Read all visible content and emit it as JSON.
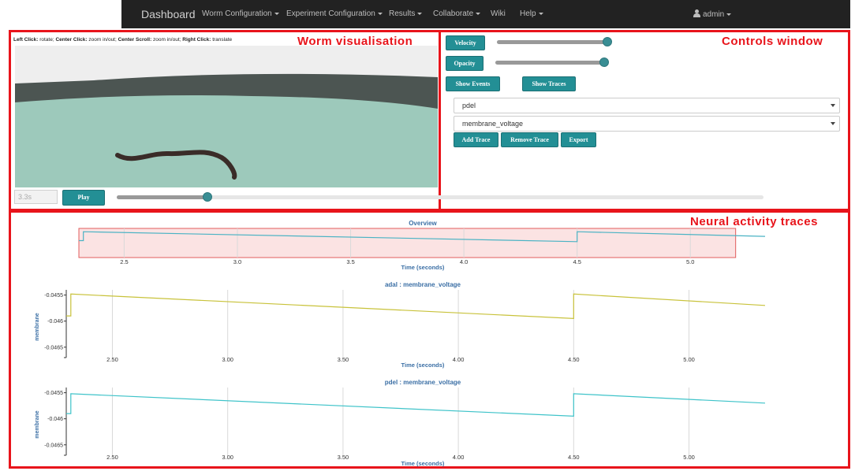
{
  "navbar": {
    "brand": "Dashboard",
    "items": [
      "Worm Configuration",
      "Experiment Configuration",
      "Results",
      "Collaborate",
      "Wiki",
      "Help"
    ],
    "user": "admin"
  },
  "annotations": {
    "worm": "Worm visualisation",
    "controls": "Controls window",
    "traces": "Neural activity traces"
  },
  "worm_view": {
    "hint_parts": [
      {
        "k": "Left Click:",
        "v": " rotate; "
      },
      {
        "k": "Center Click:",
        "v": " zoom in/out; "
      },
      {
        "k": "Center Scroll:",
        "v": " zoom in/out; "
      },
      {
        "k": "Right Click:",
        "v": " translate"
      }
    ],
    "time_value": "3.3s",
    "play_label": "Play",
    "playback_fraction": 0.14
  },
  "controls": {
    "velocity_label": "Velocity",
    "velocity_fraction": 1.0,
    "opacity_label": "Opacity",
    "opacity_fraction": 1.0,
    "show_events_label": "Show Events",
    "show_traces_label": "Show Traces",
    "neuron_select": "pdel",
    "variable_select": "membrane_voltage",
    "add_trace_label": "Add Trace",
    "remove_trace_label": "Remove Trace",
    "export_label": "Export"
  },
  "colors": {
    "accent": "#238f95",
    "frame_red": "#e8141b",
    "overview_line": "#4ab3c4",
    "adal_line": "#c8c23a",
    "pdel_line": "#3ec3c9",
    "brush_fill": "#fbe3e3",
    "axis_label": "#3b6fa5"
  },
  "chart_data": [
    {
      "type": "line",
      "title": "Overview",
      "xlabel": "Time (seconds)",
      "ylabel": "",
      "xlim": [
        2.3,
        5.33
      ],
      "ylim": [
        -0.0467,
        -0.0454
      ],
      "xticks": [
        2.5,
        3.0,
        3.5,
        4.0,
        4.5,
        5.0
      ],
      "xtick_labels": [
        "2.5",
        "3.0",
        "3.5",
        "4.0",
        "4.5",
        "5.0"
      ],
      "yticks": [],
      "ytick_labels": [],
      "brush": [
        2.3,
        5.2
      ],
      "series": [
        {
          "x": [
            2.3,
            2.32,
            2.32,
            4.5,
            4.5,
            5.33
          ],
          "y": [
            -0.0459,
            -0.0459,
            -0.04548,
            -0.04595,
            -0.04548,
            -0.0457
          ]
        }
      ]
    },
    {
      "type": "line",
      "title": "adal : membrane_voltage",
      "xlabel": "Time (seconds)",
      "ylabel": "membrane",
      "xlim": [
        2.3,
        5.33
      ],
      "ylim": [
        -0.0467,
        -0.0454
      ],
      "xticks": [
        2.5,
        3.0,
        3.5,
        4.0,
        4.5,
        5.0
      ],
      "xtick_labels": [
        "2.50",
        "3.00",
        "3.50",
        "4.00",
        "4.50",
        "5.00"
      ],
      "yticks": [
        -0.0455,
        -0.046,
        -0.0465
      ],
      "ytick_labels": [
        "-0.0455",
        "-0.046",
        "-0.0465"
      ],
      "series": [
        {
          "x": [
            2.3,
            2.32,
            2.32,
            4.5,
            4.5,
            5.33
          ],
          "y": [
            -0.0459,
            -0.0459,
            -0.04548,
            -0.04595,
            -0.04548,
            -0.0457
          ]
        }
      ]
    },
    {
      "type": "line",
      "title": "pdel : membrane_voltage",
      "xlabel": "Time (seconds)",
      "ylabel": "membrane",
      "xlim": [
        2.3,
        5.33
      ],
      "ylim": [
        -0.0467,
        -0.0454
      ],
      "xticks": [
        2.5,
        3.0,
        3.5,
        4.0,
        4.5,
        5.0
      ],
      "xtick_labels": [
        "2.50",
        "3.00",
        "3.50",
        "4.00",
        "4.50",
        "5.00"
      ],
      "yticks": [
        -0.0455,
        -0.046,
        -0.0465
      ],
      "ytick_labels": [
        "-0.0455",
        "-0.046",
        "-0.0465"
      ],
      "series": [
        {
          "x": [
            2.3,
            2.32,
            2.32,
            4.5,
            4.5,
            5.33
          ],
          "y": [
            -0.0459,
            -0.0459,
            -0.04552,
            -0.04595,
            -0.04552,
            -0.0457
          ]
        }
      ]
    }
  ]
}
